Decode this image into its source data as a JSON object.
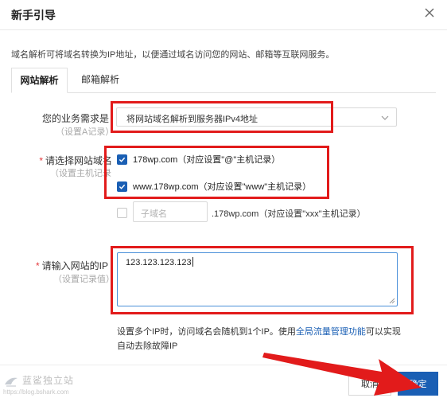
{
  "dialog": {
    "title": "新手引导",
    "description": "域名解析可将域名转换为IP地址，以便通过域名访问您的网站、邮箱等互联网服务。"
  },
  "tabs": [
    {
      "label": "网站解析",
      "active": true
    },
    {
      "label": "邮箱解析",
      "active": false
    }
  ],
  "form": {
    "need": {
      "label": "您的业务需求是",
      "hint": "（设置A记录）",
      "selected": "将网站域名解析到服务器IPv4地址"
    },
    "domain": {
      "required": "*",
      "label": "请选择网站域名",
      "hint": "（设置主机记录",
      "options": [
        {
          "label": "178wp.com（对应设置\"@\"主机记录）",
          "checked": true
        },
        {
          "label": "www.178wp.com（对应设置\"www\"主机记录）",
          "checked": true
        }
      ],
      "subdomain_placeholder": "子域名",
      "subdomain_suffix": ".178wp.com（对应设置\"xxx\"主机记录）"
    },
    "ip": {
      "required": "*",
      "label": "请输入网站的IP",
      "hint": "（设置记录值）",
      "value": "123.123.123.123"
    },
    "note_before": "设置多个IP时，访问域名会随机到1个IP。使用",
    "note_link": "全局流量管理功能",
    "note_after": "可以实现自动去除故障IP"
  },
  "footer": {
    "cancel_label": "取消",
    "ok_label": "确定"
  },
  "watermark": {
    "text": "蓝鲨独立站",
    "url": "https://blog.bshark.com"
  },
  "colors": {
    "primary": "#1a5fb4",
    "annotation": "#e21b1b",
    "link": "#1a5fb4"
  }
}
